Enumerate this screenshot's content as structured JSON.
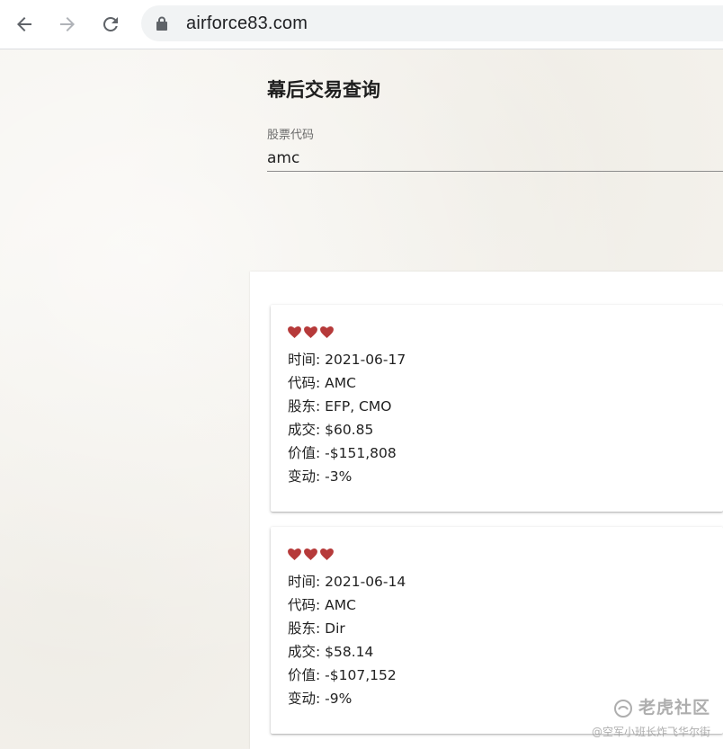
{
  "browser": {
    "url": "airforce83.com",
    "icons": {
      "back": "arrow-left-icon",
      "forward": "arrow-right-icon",
      "reload": "reload-icon",
      "lock": "lock-icon"
    }
  },
  "page": {
    "title": "幕后交易查询",
    "search": {
      "label": "股票代码",
      "value": "amc"
    }
  },
  "trades": [
    {
      "rating_hearts": 3,
      "time": "时间: 2021-06-17",
      "code": "代码: AMC",
      "holder": "股东: EFP, CMO",
      "price": "成交: $60.85",
      "value": "价值: -$151,808",
      "change": "变动: -3%"
    },
    {
      "rating_hearts": 3,
      "time": "时间: 2021-06-14",
      "code": "代码: AMC",
      "holder": "股东: Dir",
      "price": "成交: $58.14",
      "value": "价值: -$107,152",
      "change": "变动: -9%"
    }
  ],
  "watermark": {
    "main": "老虎社区",
    "sub": "@空军小班长炸飞华尔街"
  },
  "colors": {
    "heart": "#b63a3a",
    "page_bg": "#f7f5f0",
    "chrome_bg": "#ffffff",
    "omnibox_bg": "#f1f3f4"
  }
}
